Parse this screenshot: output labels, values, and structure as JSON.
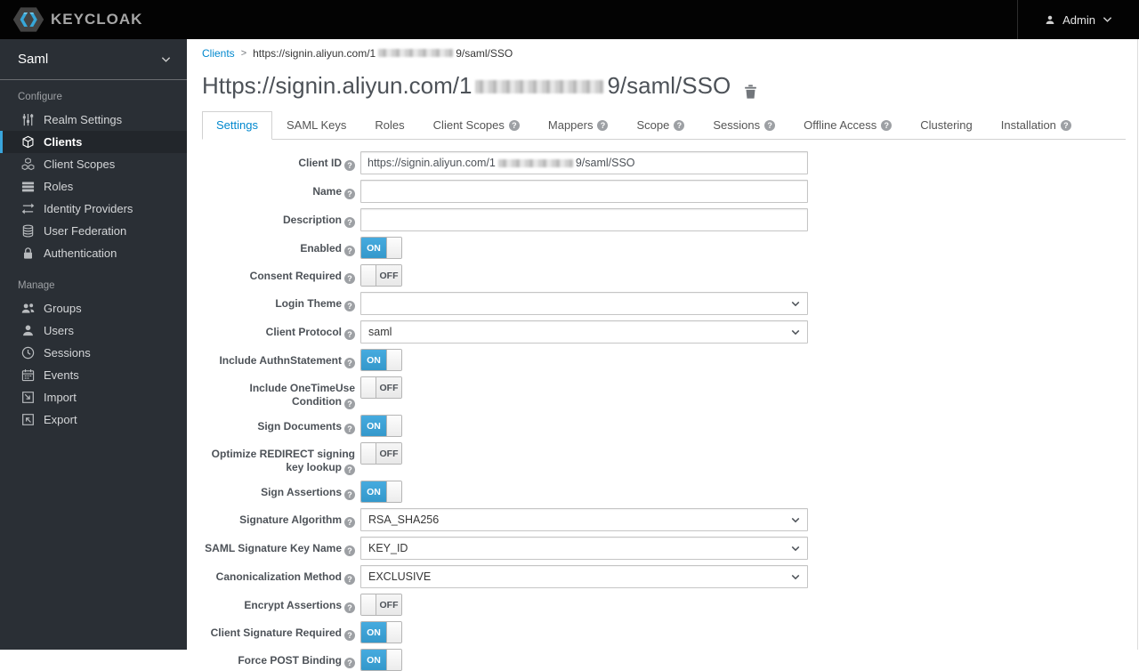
{
  "topbar": {
    "logo_text": "KEYCLOAK",
    "user_label": "Admin"
  },
  "sidebar": {
    "realm": "Saml",
    "configure_label": "Configure",
    "manage_label": "Manage",
    "configure_items": [
      {
        "label": "Realm Settings",
        "icon": "sliders-icon",
        "active": false
      },
      {
        "label": "Clients",
        "icon": "cube-icon",
        "active": true
      },
      {
        "label": "Client Scopes",
        "icon": "cubes-icon",
        "active": false
      },
      {
        "label": "Roles",
        "icon": "list-icon",
        "active": false
      },
      {
        "label": "Identity Providers",
        "icon": "exchange-icon",
        "active": false
      },
      {
        "label": "User Federation",
        "icon": "database-icon",
        "active": false
      },
      {
        "label": "Authentication",
        "icon": "lock-icon",
        "active": false
      }
    ],
    "manage_items": [
      {
        "label": "Groups",
        "icon": "users-icon"
      },
      {
        "label": "Users",
        "icon": "user-icon"
      },
      {
        "label": "Sessions",
        "icon": "clock-icon"
      },
      {
        "label": "Events",
        "icon": "calendar-icon"
      },
      {
        "label": "Import",
        "icon": "import-icon"
      },
      {
        "label": "Export",
        "icon": "export-icon"
      }
    ]
  },
  "breadcrumb": {
    "parent": "Clients",
    "separator": ">",
    "current_prefix": "https://signin.aliyun.com/1",
    "current_redacted": true,
    "current_suffix": "9/saml/SSO"
  },
  "page": {
    "title_prefix": "Https://signin.aliyun.com/1",
    "title_redacted": true,
    "title_suffix": "9/saml/SSO"
  },
  "tabs": [
    {
      "label": "Settings",
      "active": true,
      "has_help": false
    },
    {
      "label": "SAML Keys",
      "active": false,
      "has_help": false
    },
    {
      "label": "Roles",
      "active": false,
      "has_help": false
    },
    {
      "label": "Client Scopes",
      "active": false,
      "has_help": true
    },
    {
      "label": "Mappers",
      "active": false,
      "has_help": true
    },
    {
      "label": "Scope",
      "active": false,
      "has_help": true
    },
    {
      "label": "Sessions",
      "active": false,
      "has_help": true
    },
    {
      "label": "Offline Access",
      "active": false,
      "has_help": true
    },
    {
      "label": "Clustering",
      "active": false,
      "has_help": false
    },
    {
      "label": "Installation",
      "active": false,
      "has_help": true
    }
  ],
  "form": {
    "toggle_on": "ON",
    "toggle_off": "OFF",
    "client_id": {
      "label": "Client ID",
      "value_prefix": "https://signin.aliyun.com/1",
      "value_redacted": true,
      "value_suffix": "9/saml/SSO"
    },
    "name": {
      "label": "Name",
      "value": ""
    },
    "description": {
      "label": "Description",
      "value": ""
    },
    "enabled": {
      "label": "Enabled",
      "state": "ON"
    },
    "consent_required": {
      "label": "Consent Required",
      "state": "OFF"
    },
    "login_theme": {
      "label": "Login Theme",
      "value": ""
    },
    "client_protocol": {
      "label": "Client Protocol",
      "value": "saml"
    },
    "include_authnstatement": {
      "label": "Include AuthnStatement",
      "state": "ON"
    },
    "include_onetimeuse": {
      "label": "Include OneTimeUse Condition",
      "state": "OFF"
    },
    "sign_documents": {
      "label": "Sign Documents",
      "state": "ON"
    },
    "optimize_redirect": {
      "label": "Optimize REDIRECT signing key lookup",
      "state": "OFF"
    },
    "sign_assertions": {
      "label": "Sign Assertions",
      "state": "ON"
    },
    "signature_algorithm": {
      "label": "Signature Algorithm",
      "value": "RSA_SHA256"
    },
    "saml_signature_key_name": {
      "label": "SAML Signature Key Name",
      "value": "KEY_ID"
    },
    "canonicalization_method": {
      "label": "Canonicalization Method",
      "value": "EXCLUSIVE"
    },
    "encrypt_assertions": {
      "label": "Encrypt Assertions",
      "state": "OFF"
    },
    "client_signature_required": {
      "label": "Client Signature Required",
      "state": "ON"
    },
    "force_post_binding": {
      "label": "Force POST Binding",
      "state": "ON"
    }
  },
  "colors": {
    "accent": "#0088ce",
    "toggle_on_blue": "#3fa7dc",
    "sidebar_bg": "#2a2f35",
    "sidebar_active_border": "#39a5dc",
    "topbar_bg": "#030303"
  }
}
